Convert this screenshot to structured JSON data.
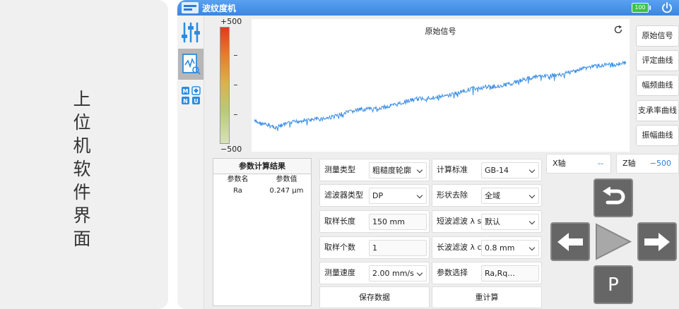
{
  "caption": "上位机软件界面",
  "app": {
    "title": "波纹度机",
    "battery": "100"
  },
  "scale": {
    "top": "+500",
    "bottom": "−500"
  },
  "chart_data": {
    "type": "line",
    "title": "原始信号",
    "line_color": "#3a8ee6"
  },
  "curve_buttons": [
    "原始信号",
    "评定曲线",
    "幅频曲线",
    "支承率曲线",
    "振幅曲线"
  ],
  "results": {
    "header": "参数计算结果",
    "columns": [
      "参数名",
      "参数值"
    ],
    "rows": [
      {
        "name": "Ra",
        "value": "0.247 μm"
      }
    ]
  },
  "params": {
    "measure_type": {
      "label": "测量类型",
      "value": "粗糙度轮廓"
    },
    "filter_type": {
      "label": "滤波器类型",
      "value": "DP"
    },
    "sample_length": {
      "label": "取样长度",
      "value": "150 mm"
    },
    "sample_count": {
      "label": "取样个数",
      "value": "1"
    },
    "speed": {
      "label": "测量速度",
      "value": "2.00 mm/s"
    },
    "standard": {
      "label": "计算标准",
      "value": "GB-14"
    },
    "form_removal": {
      "label": "形状去除",
      "value": "全域"
    },
    "short_filter": {
      "label": "短波滤波 λ s",
      "value": "默认"
    },
    "long_filter": {
      "label": "长波滤波 λ c",
      "value": "0.8 mm"
    },
    "param_select": {
      "label": "参数选择",
      "value": "Ra,Rq..."
    }
  },
  "actions": {
    "save": "保存数据",
    "recalc": "重计算"
  },
  "axes": {
    "x": {
      "label": "X轴",
      "value": "--"
    },
    "z": {
      "label": "Z轴",
      "value": "−500"
    }
  },
  "pad": {
    "p_label": "P"
  },
  "colors": {
    "titlebar": "#3b86e0",
    "accent": "#2c7fd8",
    "battery": "#3cc24a"
  }
}
